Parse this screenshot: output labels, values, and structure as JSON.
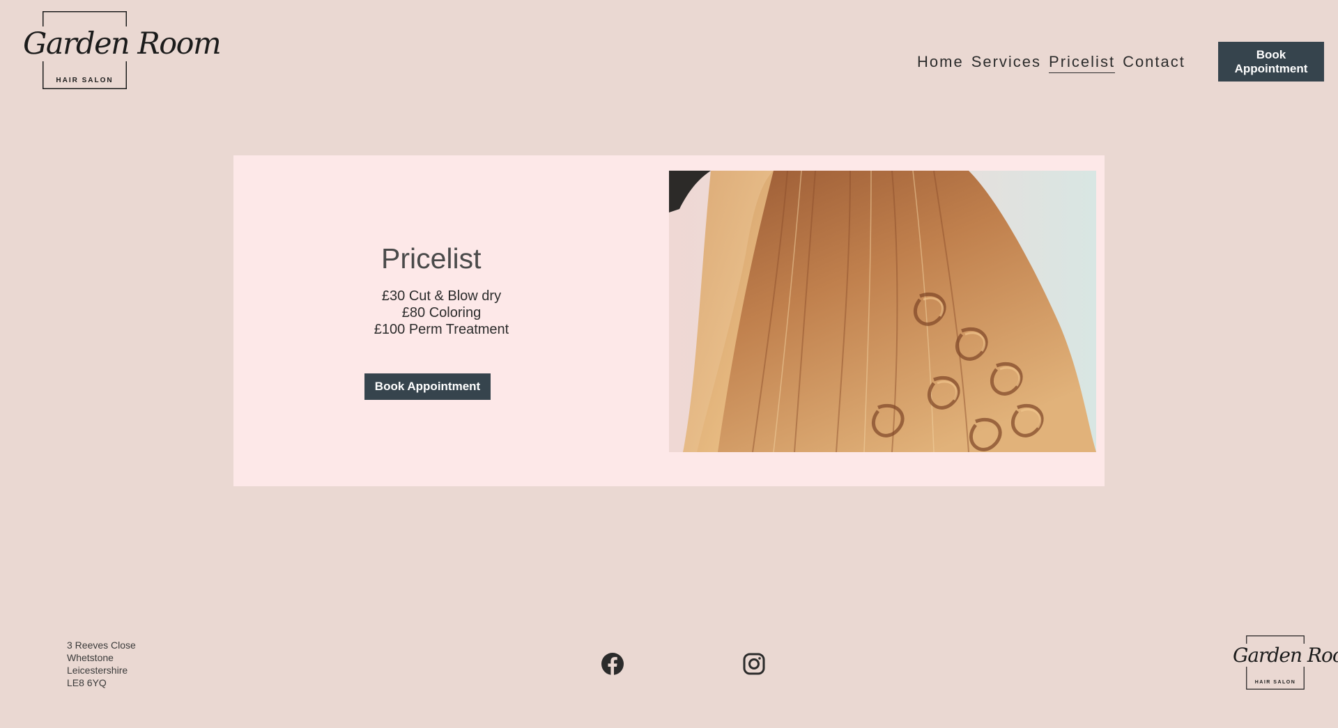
{
  "header": {
    "logo": {
      "script": "Garden Room",
      "subtitle": "HAIR SALON"
    },
    "nav": [
      {
        "label": "Home",
        "active": false
      },
      {
        "label": "Services",
        "active": false
      },
      {
        "label": "Pricelist",
        "active": true
      },
      {
        "label": "Contact",
        "active": false
      }
    ],
    "book_label": "Book\nAppointment"
  },
  "main": {
    "title": "Pricelist",
    "prices": [
      "£30 Cut & Blow dry",
      "£80 Coloring",
      "£100 Perm Treatment"
    ],
    "book_label": "Book Appointment"
  },
  "footer": {
    "address": [
      "3 Reeves Close",
      "Whetstone",
      "Leicestershire",
      "LE8 6YQ"
    ],
    "social": [
      "facebook-icon",
      "instagram-icon"
    ],
    "logo": {
      "script": "Garden Room",
      "subtitle": "HAIR SALON"
    }
  },
  "colors": {
    "background": "#ead8d2",
    "card": "#fde8e8",
    "button": "#36444d",
    "button_text": "#ffffff"
  }
}
